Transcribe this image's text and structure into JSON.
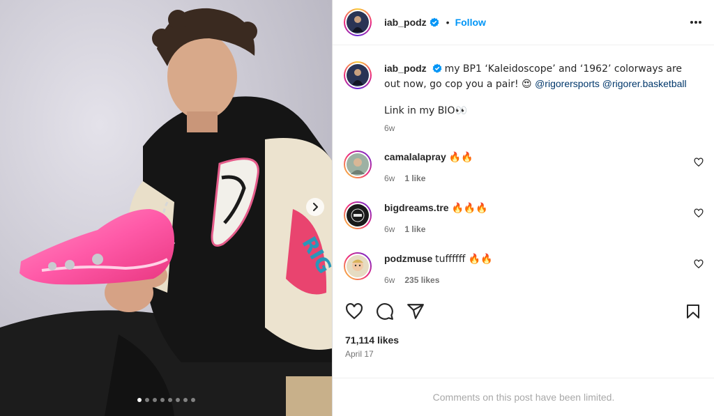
{
  "post": {
    "author": "iab_podz",
    "follow_label": "Follow",
    "separator": "•",
    "caption_text": "my BP1 ‘Kaleidoscope’ and ‘1962’ colorways are out now, go cop you a pair! 😍 ",
    "mentions": [
      "@rigorersports",
      "@rigorer.basketball"
    ],
    "caption_link": "Link in my BIO👀",
    "caption_age": "6w",
    "likes": "71,114 likes",
    "date": "April 17",
    "limited_notice": "Comments on this post have been limited.",
    "carousel": {
      "count": 8,
      "active_index": 0
    }
  },
  "comments": [
    {
      "user": "camalalapray",
      "text": "🔥🔥",
      "age": "6w",
      "likes": "1 like",
      "avatar_color": "#9db1a3"
    },
    {
      "user": "bigdreams.tre",
      "text": "🔥🔥🔥",
      "age": "6w",
      "likes": "1 like",
      "avatar_color": "#1a1a1a"
    },
    {
      "user": "podzmuse",
      "text": "tuffffff 🔥🔥",
      "age": "6w",
      "likes": "235 likes",
      "avatar_color": "#e6dcc2"
    }
  ],
  "icons": {
    "more": "more-horizontal-icon",
    "next": "chevron-right-icon",
    "like": "heart-icon",
    "comment": "comment-icon",
    "share": "share-icon",
    "save": "bookmark-icon",
    "verified": "verified-badge-icon"
  },
  "colors": {
    "link": "#0095f6",
    "mention": "#00376b",
    "verified": "#0095f6",
    "secondary_text": "#737373"
  }
}
